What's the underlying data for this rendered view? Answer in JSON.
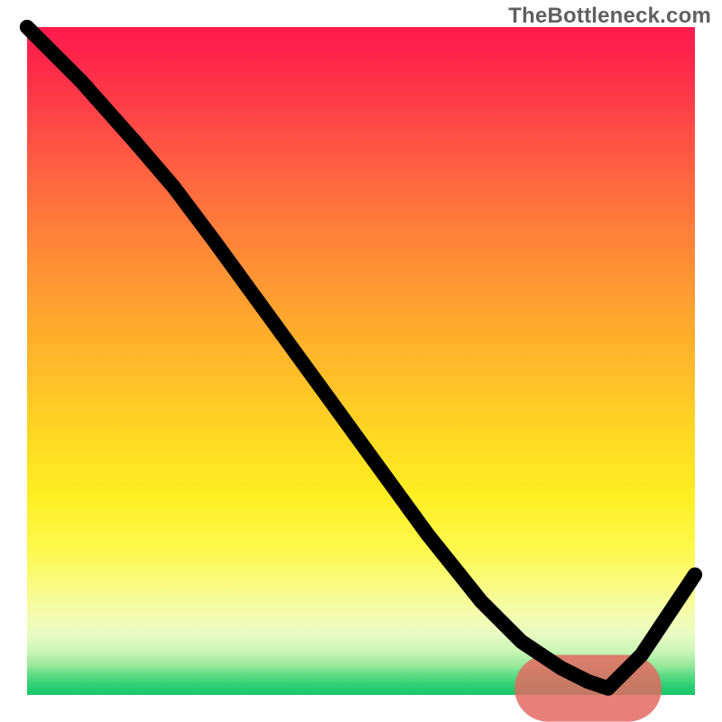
{
  "watermark": "TheBottleneck.com",
  "chart_data": {
    "type": "line",
    "title": "",
    "xlabel": "",
    "ylabel": "",
    "xlim": [
      0,
      100
    ],
    "ylim": [
      0,
      100
    ],
    "grid": false,
    "series": [
      {
        "name": "curve",
        "color": "#000000",
        "x": [
          0,
          8,
          16,
          22,
          28,
          36,
          44,
          52,
          60,
          68,
          74,
          80,
          84,
          87,
          92,
          96,
          100
        ],
        "y": [
          100,
          92,
          83,
          76,
          68,
          57,
          46,
          35,
          24,
          14,
          8,
          4,
          2,
          1,
          6,
          12,
          18
        ]
      }
    ],
    "highlight_band": {
      "x_start": 78,
      "x_end": 90,
      "y": 1,
      "color": "#e36a62"
    },
    "background_gradient": {
      "direction": "vertical",
      "stops": [
        {
          "pos": 0.0,
          "color": "#ff1a4d"
        },
        {
          "pos": 0.24,
          "color": "#ff6a3e"
        },
        {
          "pos": 0.54,
          "color": "#ffc327"
        },
        {
          "pos": 0.78,
          "color": "#fdf84a"
        },
        {
          "pos": 0.91,
          "color": "#e8fbc2"
        },
        {
          "pos": 1.0,
          "color": "#16c768"
        }
      ]
    }
  }
}
